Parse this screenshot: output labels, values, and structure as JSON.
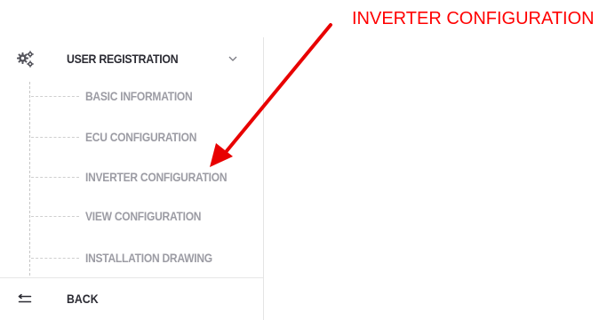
{
  "annotation": {
    "text": "INVERTER CONFIGURATION",
    "color": "#ff0000",
    "target": "sub-item-inverter-configuration"
  },
  "sidebar": {
    "header": {
      "icon": "gears-icon",
      "label": "USER REGISTRATION",
      "state": "expanded"
    },
    "items": [
      {
        "label": "BASIC INFORMATION"
      },
      {
        "label": "ECU CONFIGURATION"
      },
      {
        "label": "INVERTER CONFIGURATION"
      },
      {
        "label": "VIEW CONFIGURATION"
      },
      {
        "label": "INSTALLATION DRAWING"
      }
    ],
    "back": {
      "icon": "back-icon",
      "label": "BACK"
    }
  },
  "colors": {
    "header_text": "#2b2b33",
    "item_text": "#9c9ca4",
    "annotation": "#ff0000"
  }
}
